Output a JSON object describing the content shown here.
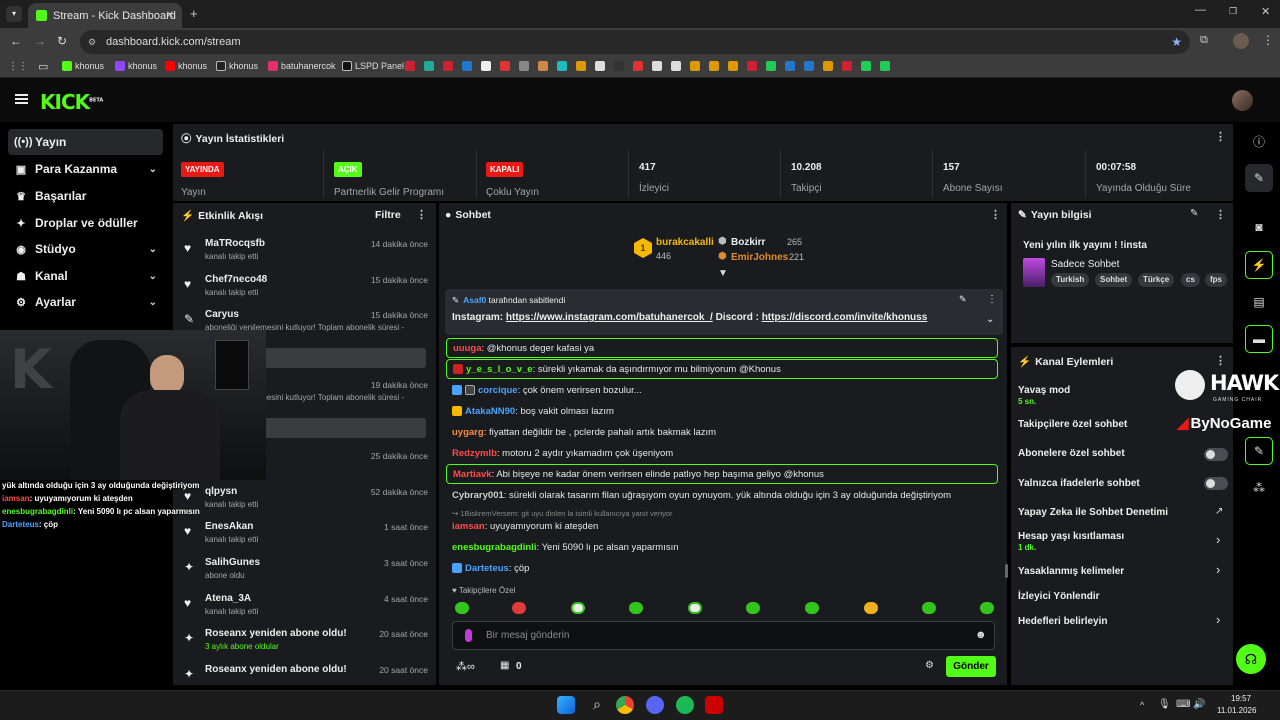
{
  "browser": {
    "tab_title": "Stream - Kick Dashboard",
    "url": "dashboard.kick.com/stream"
  },
  "bookmarks": [
    {
      "label": "khonus",
      "color": "#53fc18"
    },
    {
      "label": "khonus",
      "color": "#9146ff"
    },
    {
      "label": "khonus",
      "color": "#ff0000"
    },
    {
      "label": "khonus",
      "color": "#dddddd"
    },
    {
      "label": "batuhanercok",
      "color": "#e1306c"
    },
    {
      "label": "LSPD Panel",
      "color": "#dddddd"
    }
  ],
  "brand": {
    "logo": "KICK",
    "logo_sup": "BETA",
    "accent": "#53fc18"
  },
  "sidebar": {
    "items": [
      {
        "label": "Yayın",
        "icon": "broadcast-icon",
        "active": true,
        "chevron": false
      },
      {
        "label": "Para Kazanma",
        "icon": "money-icon",
        "chevron": true
      },
      {
        "label": "Başarılar",
        "icon": "trophy-icon",
        "chevron": false
      },
      {
        "label": "Droplar ve ödüller",
        "icon": "gift-icon",
        "chevron": false
      },
      {
        "label": "Stüdyo",
        "icon": "studio-icon",
        "chevron": true
      },
      {
        "label": "Kanal",
        "icon": "channel-icon",
        "chevron": true
      },
      {
        "label": "Ayarlar",
        "icon": "gear-icon",
        "chevron": true
      }
    ]
  },
  "webcam_overlay": {
    "lines": [
      {
        "user": "",
        "text": "yük altında olduğu için 3 ay olduğunda değiştiriyom",
        "ucolor": "#ffffff"
      },
      {
        "user": "iamsan",
        "text": ": uyuyamıyorum ki ateşden",
        "ucolor": "#ff4b4b"
      },
      {
        "user": "enesbugrabagdinli",
        "text": ": Yeni 5090 lı pc alsan yaparmısın",
        "ucolor": "#53fc18"
      },
      {
        "user": "Darteteus",
        "text": ": çöp",
        "ucolor": "#4aa3ff"
      }
    ]
  },
  "stats": {
    "title": "Yayın İstatistikleri",
    "items": [
      {
        "badge": "YAYINDA",
        "label": "Yayın",
        "badge_color": "#e91916"
      },
      {
        "badge": "AÇIK",
        "label": "Partnerlik Gelir Programı",
        "badge_color": "#53fc18"
      },
      {
        "badge": "KAPALI",
        "label": "Çoklu Yayın",
        "badge_color": "#e91916"
      },
      {
        "value": "417",
        "label": "İzleyici"
      },
      {
        "value": "10.208",
        "label": "Takipçi"
      },
      {
        "value": "157",
        "label": "Abone Sayısı"
      },
      {
        "value": "00:07:58",
        "label": "Yayında Olduğu Süre"
      }
    ]
  },
  "events": {
    "title": "Etkinlik Akışı",
    "filter": "Filtre",
    "items": [
      {
        "name": "MaTRocqsfb",
        "sub": "kanalı takip etti",
        "time": "14 dakika önce",
        "icon": "heart-icon"
      },
      {
        "name": "Chef7neco48",
        "sub": "kanalı takip etti",
        "time": "15 dakika önce",
        "icon": "heart-icon"
      },
      {
        "name": "Caryus",
        "sub": "aboneliği yenilemesini kutluyor! Toplam abonelik süresi -",
        "time": "15 dakika önce",
        "icon": "celebrate-icon"
      },
      {
        "name": "",
        "sub": "aboneliği yenilemesini kutluyor! Toplam abonelik süresi -",
        "time": "19 dakika önce",
        "icon": ""
      },
      {
        "name": "",
        "sub": "",
        "time": "25 dakika önce",
        "icon": ""
      },
      {
        "name": "qlpysn",
        "sub": "kanalı takip etti",
        "time": "52 dakika önce",
        "icon": "heart-icon"
      },
      {
        "name": "EnesAkan",
        "sub": "kanalı takip etti",
        "time": "1 saat önce",
        "icon": "heart-icon"
      },
      {
        "name": "SalihGunes",
        "sub": "abone oldu",
        "time": "3 saat önce",
        "icon": "sparkle-icon"
      },
      {
        "name": "Atena_3A",
        "sub": "kanalı takip etti",
        "time": "4 saat önce",
        "icon": "heart-icon"
      },
      {
        "name": "Roseanx yeniden abone oldu!",
        "sub": "3 aylık abone oldular",
        "time": "20 saat önce",
        "icon": "sparkle-icon"
      },
      {
        "name": "Roseanx yeniden abone oldu!",
        "sub": "",
        "time": "20 saat önce",
        "icon": "sparkle-icon"
      }
    ]
  },
  "chat": {
    "title": "Sohbet",
    "leaders": [
      {
        "rank": "1",
        "name": "burakcakalli",
        "value": "446"
      },
      {
        "name": "Bozkirr",
        "value": "265"
      },
      {
        "name": "EmirJohnes",
        "value": "221"
      }
    ],
    "pinned": {
      "by": "Asaf0",
      "by_suffix": "tarafından sabitlendi",
      "prefix": "Instagram: ",
      "link1": "https://www.instagram.com/batuhanercok_/",
      "mid": "  Discord : ",
      "link2": "https://discord.com/invite/khonuss"
    },
    "messages": [
      {
        "user": "uuuga",
        "text": ": @khonus deger kafasi ya",
        "color": "#ff4b4b",
        "hl": true
      },
      {
        "user": "y_e_s_l_o_v_e",
        "text": ": sürekli yıkamak da aşındırmıyor mu bilmiyorum @Khonus",
        "color": "#53fc18",
        "hl": true
      },
      {
        "user": "corcique",
        "text": ": çok önem verirsen bozulur...",
        "color": "#4aa3ff",
        "hl": false
      },
      {
        "user": "AtakaNN90",
        "text": ": boş vakit olması lazım",
        "color": "#4aa3ff",
        "hl": false
      },
      {
        "user": "uygarg",
        "text": ": fiyattan değildir be , pclerde pahalı artık bakmak lazım",
        "color": "#ff8a3d",
        "hl": false
      },
      {
        "user": "Redzymlb",
        "text": ": motoru 2 aydır yıkamadım çok üşeniyom",
        "color": "#ff4b4b",
        "hl": false
      },
      {
        "user": "Martiavk",
        "text": ": Abi bişeye ne kadar önem verirsen elinde patlıyo hep başıma geliyo @khonus",
        "color": "#ff4b4b",
        "hl": true
      },
      {
        "user": "Cybrary001",
        "text": ": sürekli olarak tasarım filan uğraşıyom oyun oynuyom. yük altında olduğu için 3 ay olduğunda değiştiriyom",
        "color": "#cfcfcf",
        "hl": false
      },
      {
        "user": "iamsan",
        "text": ": uyuyamıyorum ki ateşden",
        "color": "#ff4b4b",
        "hl": false,
        "reply": "1BiskremVersem: git uyu dinlen la isimli kullanıcıya yanıt veriyor"
      },
      {
        "user": "enesbugrabagdinli",
        "text": ": Yeni 5090 lı pc alsan yaparmısın",
        "color": "#53fc18",
        "hl": false
      },
      {
        "user": "Darteteus",
        "text": ": çöp",
        "color": "#4aa3ff",
        "hl": false
      }
    ],
    "mode": "Takipçilere Özel",
    "input_placeholder": "Bir mesaj gönderin",
    "points": "0",
    "send": "Gönder"
  },
  "stream_info": {
    "title": "Yayın bilgisi",
    "stream_title": "Yeni yılın ilk yayını ! !insta",
    "category": "Sadece Sohbet",
    "tags": [
      "Turkish",
      "Sohbet",
      "Türkçe",
      "cs",
      "fps"
    ]
  },
  "channel_actions": {
    "title": "Kanal Eylemleri",
    "items": [
      {
        "label": "Yavaş mod",
        "sub": "5 sn."
      },
      {
        "label": "Takipçilere özel sohbet"
      },
      {
        "label": "Abonelere özel sohbet",
        "toggle": true
      },
      {
        "label": "Yalnızca ifadelerle sohbet",
        "toggle": true
      },
      {
        "label": "Yapay Zeka ile Sohbet Denetimi"
      },
      {
        "label": "Hesap yaşı kısıtlaması",
        "sub": "1 dk."
      },
      {
        "label": "Yasaklanmış kelimeler"
      },
      {
        "label": "İzleyici Yönlendir"
      },
      {
        "label": "Hedefleri belirleyin"
      }
    ]
  },
  "overlay_brand": {
    "hawk": "HAWK",
    "hawk_sub": "GAMING CHAIR",
    "bynogame": "ByNoGame"
  },
  "taskbar": {
    "time": "19:57",
    "date": "11.01.2026"
  }
}
